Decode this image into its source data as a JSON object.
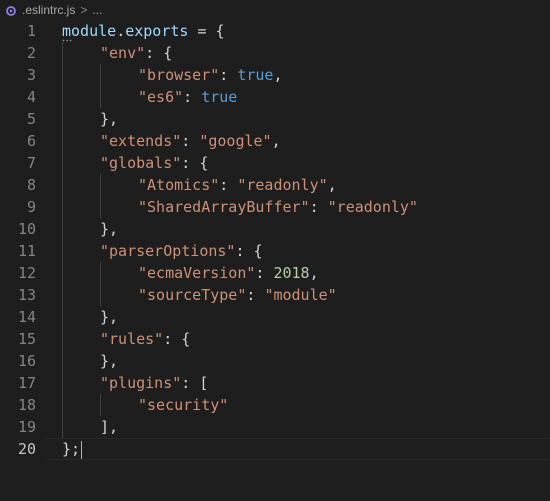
{
  "breadcrumb": {
    "file_icon": "eslint-circle-icon",
    "file_name": ".eslintrc.js",
    "separator": ">",
    "ellipsis": "..."
  },
  "editor": {
    "active_line": 20,
    "colors": {
      "background": "#1e1e1e",
      "line_number": "#858585",
      "active_line_number": "#c6c6c6",
      "variable": "#9cdcfe",
      "property": "#4fc1ff",
      "string": "#ce9178",
      "boolean": "#569cd6",
      "number": "#b5cea8",
      "punctuation": "#d4d4d4"
    },
    "lines": [
      {
        "n": "1",
        "indent": 0,
        "tokens": [
          {
            "t": "module",
            "c": "var"
          },
          {
            "t": ".",
            "c": "punc"
          },
          {
            "t": "exports",
            "c": "var"
          },
          {
            "t": " = {",
            "c": "punc"
          }
        ]
      },
      {
        "n": "2",
        "indent": 1,
        "tokens": [
          {
            "t": "\"env\"",
            "c": "key"
          },
          {
            "t": ": {",
            "c": "punc"
          }
        ]
      },
      {
        "n": "3",
        "indent": 2,
        "tokens": [
          {
            "t": "\"browser\"",
            "c": "key"
          },
          {
            "t": ": ",
            "c": "punc"
          },
          {
            "t": "true",
            "c": "bool"
          },
          {
            "t": ",",
            "c": "punc"
          }
        ]
      },
      {
        "n": "4",
        "indent": 2,
        "tokens": [
          {
            "t": "\"es6\"",
            "c": "key"
          },
          {
            "t": ": ",
            "c": "punc"
          },
          {
            "t": "true",
            "c": "bool"
          }
        ]
      },
      {
        "n": "5",
        "indent": 1,
        "tokens": [
          {
            "t": "},",
            "c": "punc"
          }
        ]
      },
      {
        "n": "6",
        "indent": 1,
        "tokens": [
          {
            "t": "\"extends\"",
            "c": "key"
          },
          {
            "t": ": ",
            "c": "punc"
          },
          {
            "t": "\"google\"",
            "c": "str"
          },
          {
            "t": ",",
            "c": "punc"
          }
        ]
      },
      {
        "n": "7",
        "indent": 1,
        "tokens": [
          {
            "t": "\"globals\"",
            "c": "key"
          },
          {
            "t": ": {",
            "c": "punc"
          }
        ]
      },
      {
        "n": "8",
        "indent": 2,
        "tokens": [
          {
            "t": "\"Atomics\"",
            "c": "key"
          },
          {
            "t": ": ",
            "c": "punc"
          },
          {
            "t": "\"readonly\"",
            "c": "str"
          },
          {
            "t": ",",
            "c": "punc"
          }
        ]
      },
      {
        "n": "9",
        "indent": 2,
        "tokens": [
          {
            "t": "\"SharedArrayBuffer\"",
            "c": "key"
          },
          {
            "t": ": ",
            "c": "punc"
          },
          {
            "t": "\"readonly\"",
            "c": "str"
          }
        ]
      },
      {
        "n": "10",
        "indent": 1,
        "tokens": [
          {
            "t": "},",
            "c": "punc"
          }
        ]
      },
      {
        "n": "11",
        "indent": 1,
        "tokens": [
          {
            "t": "\"parserOptions\"",
            "c": "key"
          },
          {
            "t": ": {",
            "c": "punc"
          }
        ]
      },
      {
        "n": "12",
        "indent": 2,
        "tokens": [
          {
            "t": "\"ecmaVersion\"",
            "c": "key"
          },
          {
            "t": ": ",
            "c": "punc"
          },
          {
            "t": "2018",
            "c": "num"
          },
          {
            "t": ",",
            "c": "punc"
          }
        ]
      },
      {
        "n": "13",
        "indent": 2,
        "tokens": [
          {
            "t": "\"sourceType\"",
            "c": "key"
          },
          {
            "t": ": ",
            "c": "punc"
          },
          {
            "t": "\"module\"",
            "c": "str"
          }
        ]
      },
      {
        "n": "14",
        "indent": 1,
        "tokens": [
          {
            "t": "},",
            "c": "punc"
          }
        ]
      },
      {
        "n": "15",
        "indent": 1,
        "tokens": [
          {
            "t": "\"rules\"",
            "c": "key"
          },
          {
            "t": ": {",
            "c": "punc"
          }
        ]
      },
      {
        "n": "16",
        "indent": 1,
        "tokens": [
          {
            "t": "},",
            "c": "punc"
          }
        ]
      },
      {
        "n": "17",
        "indent": 1,
        "tokens": [
          {
            "t": "\"plugins\"",
            "c": "key"
          },
          {
            "t": ": [",
            "c": "punc"
          }
        ]
      },
      {
        "n": "18",
        "indent": 2,
        "tokens": [
          {
            "t": "\"security\"",
            "c": "str"
          }
        ]
      },
      {
        "n": "19",
        "indent": 1,
        "tokens": [
          {
            "t": "],",
            "c": "punc"
          }
        ]
      },
      {
        "n": "20",
        "indent": 0,
        "tokens": [
          {
            "t": "};",
            "c": "punc"
          }
        ]
      }
    ]
  }
}
